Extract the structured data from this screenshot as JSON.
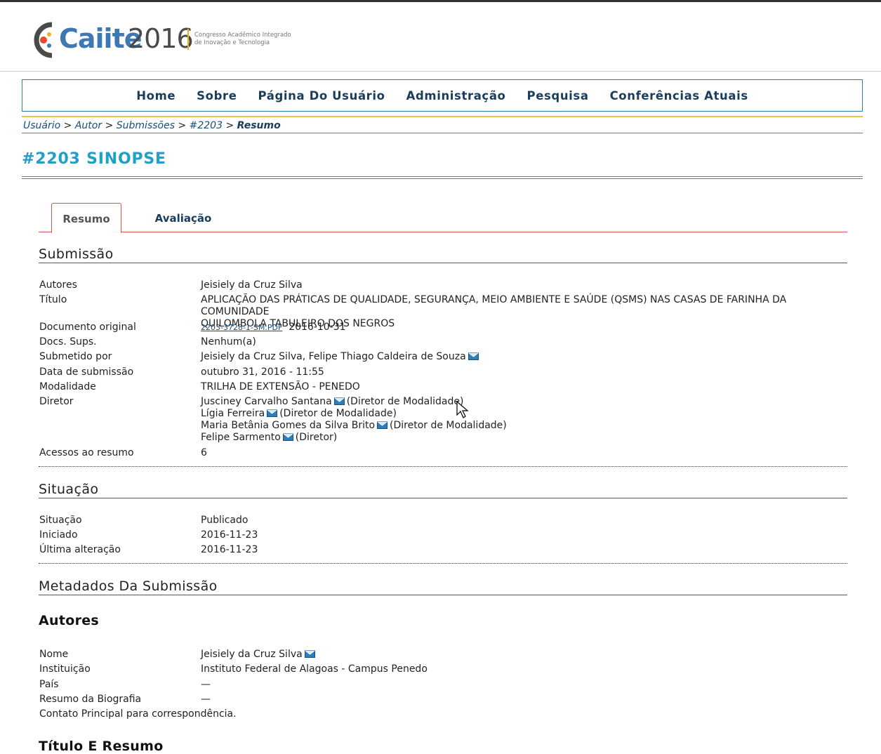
{
  "logo": {
    "word": "Caiite",
    "year": "2016",
    "subtitle_line1": "Congresso Acadêmico Integrado",
    "subtitle_line2": "de Inovação e Tecnologia"
  },
  "nav": [
    "Home",
    "Sobre",
    "Página Do Usuário",
    "Administração",
    "Pesquisa",
    "Conferências Atuais"
  ],
  "breadcrumb": {
    "items": [
      "Usuário",
      "Autor",
      "Submissões",
      "#2203"
    ],
    "current": "Resumo",
    "separator": ">"
  },
  "page_title": "#2203 SINOPSE",
  "tabs": [
    "Resumo",
    "Avaliação"
  ],
  "submission": {
    "heading": "Submissão",
    "autores_label": "Autores",
    "autores": "Jeisiely da Cruz Silva",
    "titulo_label": "Título",
    "titulo_line1": "APLICAÇÃO DAS PRÁTICAS DE QUALIDADE, SEGURANÇA, MEIO AMBIENTE E SAÚDE (QSMS) NAS CASAS DE FARINHA DA COMUNIDADE",
    "titulo_line2": "QUILOMBOLA TABULEIRO DOS NEGROS",
    "doc_label": "Documento original",
    "doc_file": "2203-3728-1-SM.PDF",
    "doc_date": "2016-10-31",
    "supp_label": "Docs. Sups.",
    "supp": "Nenhum(a)",
    "submitted_label": "Submetido por",
    "submitted_by": "Jeisiely da Cruz Silva, Felipe Thiago Caldeira de Souza",
    "date_label": "Data de submissão",
    "date": "outubro 31, 2016 - 11:55",
    "mod_label": "Modalidade",
    "modalidade": "TRILHA DE EXTENSÃO - PENEDO",
    "dir_label": "Diretor",
    "directors": [
      {
        "name": "Jusciney Carvalho Santana",
        "role": "(Diretor de Modalidade)"
      },
      {
        "name": "Lígia Ferreira",
        "role": "(Diretor de Modalidade)"
      },
      {
        "name": "Maria Betânia Gomes da Silva Brito",
        "role": "(Diretor de Modalidade)"
      },
      {
        "name": "Felipe Sarmento",
        "role": "(Diretor)"
      }
    ],
    "access_label": "Acessos ao resumo",
    "access": "6"
  },
  "status": {
    "heading": "Situação",
    "sit_label": "Situação",
    "sit": "Publicado",
    "start_label": "Iniciado",
    "start": "2016-11-23",
    "last_label": "Última alteração",
    "last": "2016-11-23"
  },
  "metadata": {
    "heading": "Metadados Da Submissão",
    "authors_heading": "Autores",
    "name_label": "Nome",
    "name": "Jeisiely da Cruz Silva",
    "inst_label": "Instituição",
    "inst": "Instituto Federal de Alagoas - Campus Penedo",
    "country_label": "País",
    "country": "—",
    "bio_label": "Resumo da Biografia",
    "bio": "—",
    "contact": "Contato Principal para correspondência.",
    "title_heading": "Título E Resumo"
  },
  "colors": {
    "accent": "#1fa0c7",
    "nav_text": "#1b3d5c",
    "tab_border": "#d9534f"
  }
}
